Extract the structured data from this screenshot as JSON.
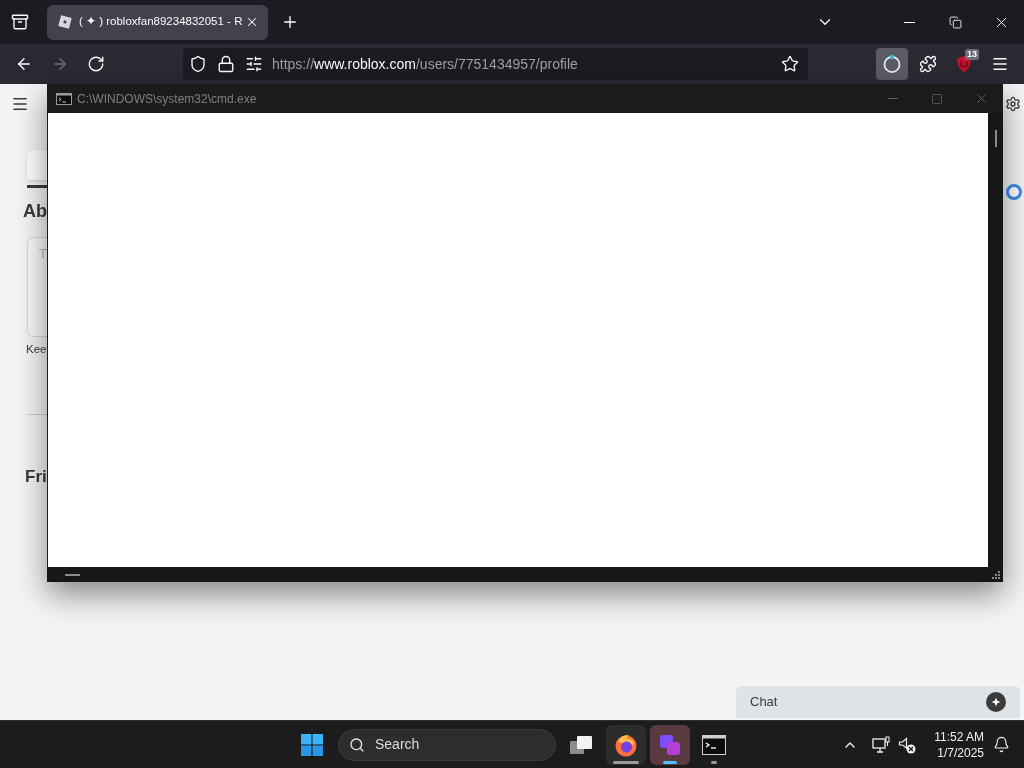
{
  "browser": {
    "tabs": [
      {
        "title": "( ✦ ) robloxfan89234832051 - R",
        "selected": true
      }
    ],
    "nav_buttons": [
      {
        "kind": "back",
        "disabled": false
      },
      {
        "kind": "forward",
        "disabled": true
      },
      {
        "kind": "reload",
        "disabled": false
      }
    ],
    "address_bar": {
      "scheme": "https://",
      "domain": "www.roblox.com",
      "path": "/users/7751434957/profile"
    },
    "toolbar_buttons": [
      {
        "kind": "ring",
        "selected": true
      },
      {
        "kind": "puzzle",
        "selected": false
      },
      {
        "kind": "shield",
        "selected": false,
        "badge": "13"
      },
      {
        "kind": "menu",
        "selected": false
      }
    ]
  },
  "cmd_window": {
    "title": "C:\\WINDOWS\\system32\\cmd.exe"
  },
  "page": {
    "heading": "Ab",
    "text_area": {
      "placeholder": "T"
    },
    "caption": "Kee",
    "section_heading": "Fri",
    "chat": {
      "label": "Chat"
    }
  },
  "taskbar": {
    "search": {
      "placeholder": "Search"
    },
    "apps": [
      {
        "kind": "browser",
        "selected": false,
        "hovered": true
      },
      {
        "kind": "app",
        "selected": true,
        "hovered": false
      },
      {
        "kind": "terminal",
        "selected": false,
        "hovered": false
      }
    ],
    "tray": {
      "volume": {
        "muted": true
      }
    },
    "clock": {
      "time": "11:52 AM",
      "date": "1/7/2025"
    }
  }
}
